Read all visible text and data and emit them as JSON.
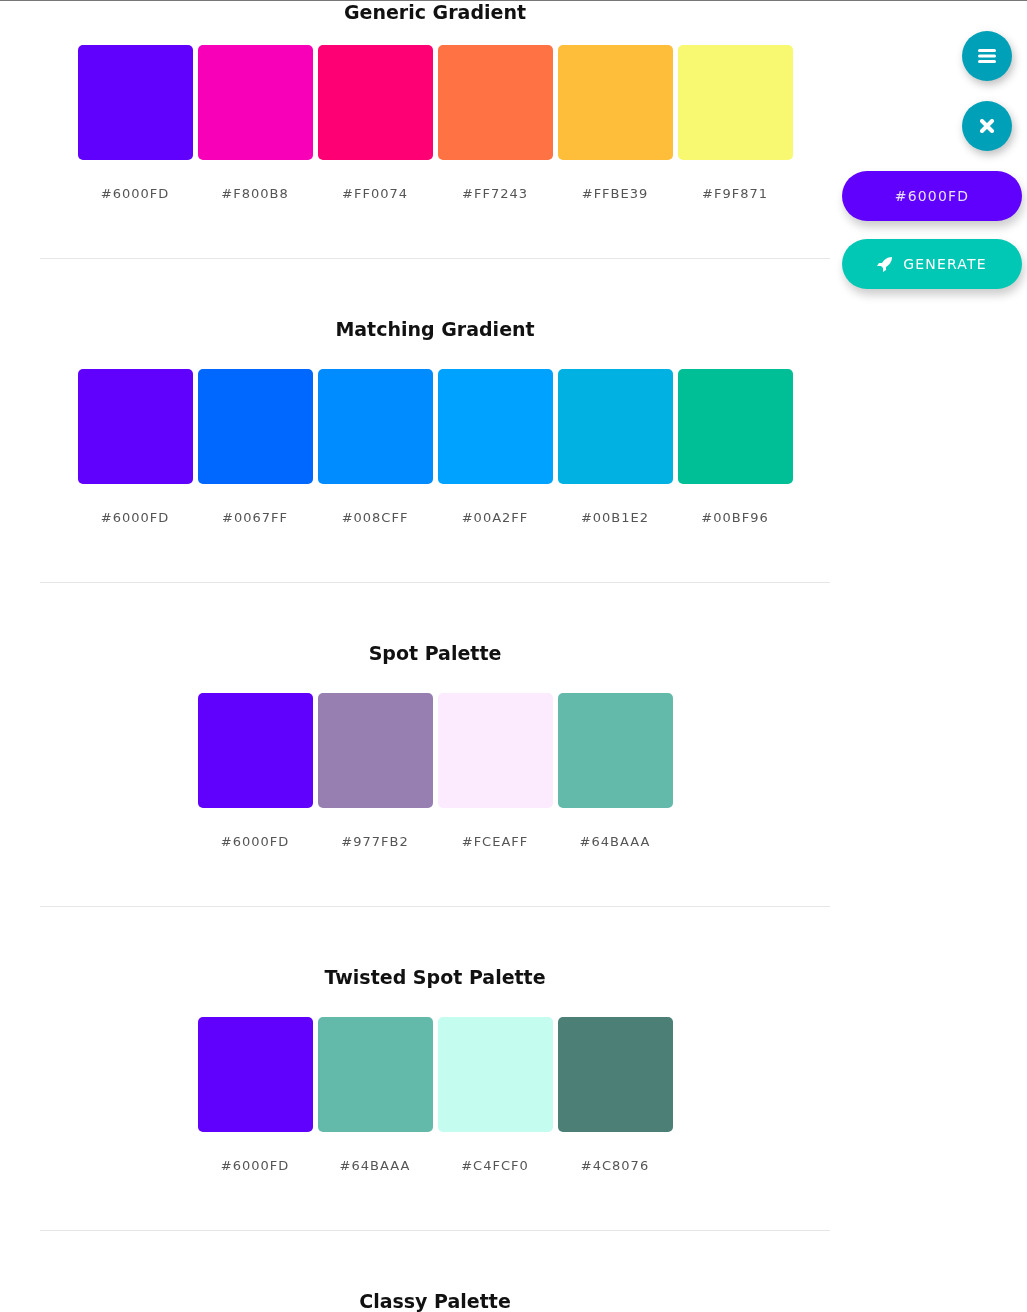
{
  "sections": [
    {
      "title": "Generic Gradient",
      "swatches": [
        {
          "color": "#6000fd",
          "code": "#6000FD"
        },
        {
          "color": "#f800b8",
          "code": "#F800B8"
        },
        {
          "color": "#ff0074",
          "code": "#FF0074"
        },
        {
          "color": "#ff7243",
          "code": "#FF7243"
        },
        {
          "color": "#ffbe39",
          "code": "#FFBE39"
        },
        {
          "color": "#f9f871",
          "code": "#F9F871"
        }
      ]
    },
    {
      "title": "Matching Gradient",
      "swatches": [
        {
          "color": "#6000fd",
          "code": "#6000FD"
        },
        {
          "color": "#0067ff",
          "code": "#0067FF"
        },
        {
          "color": "#008cff",
          "code": "#008CFF"
        },
        {
          "color": "#00a2ff",
          "code": "#00A2FF"
        },
        {
          "color": "#00b1e2",
          "code": "#00B1E2"
        },
        {
          "color": "#00bf96",
          "code": "#00BF96"
        }
      ]
    },
    {
      "title": "Spot Palette",
      "swatches": [
        {
          "color": "#6000fd",
          "code": "#6000FD"
        },
        {
          "color": "#977fb2",
          "code": "#977FB2"
        },
        {
          "color": "#fceaff",
          "code": "#FCEAFF"
        },
        {
          "color": "#64baaa",
          "code": "#64BAAA"
        }
      ]
    },
    {
      "title": "Twisted Spot Palette",
      "swatches": [
        {
          "color": "#6000fd",
          "code": "#6000FD"
        },
        {
          "color": "#64baaa",
          "code": "#64BAAA"
        },
        {
          "color": "#c4fcf0",
          "code": "#C4FCF0"
        },
        {
          "color": "#4c8076",
          "code": "#4C8076"
        }
      ]
    },
    {
      "title": "Classy Palette"
    }
  ],
  "actions": {
    "current_color": {
      "label": "#6000FD",
      "color": "#6000fd"
    },
    "generate": {
      "label": "GENERATE"
    }
  }
}
